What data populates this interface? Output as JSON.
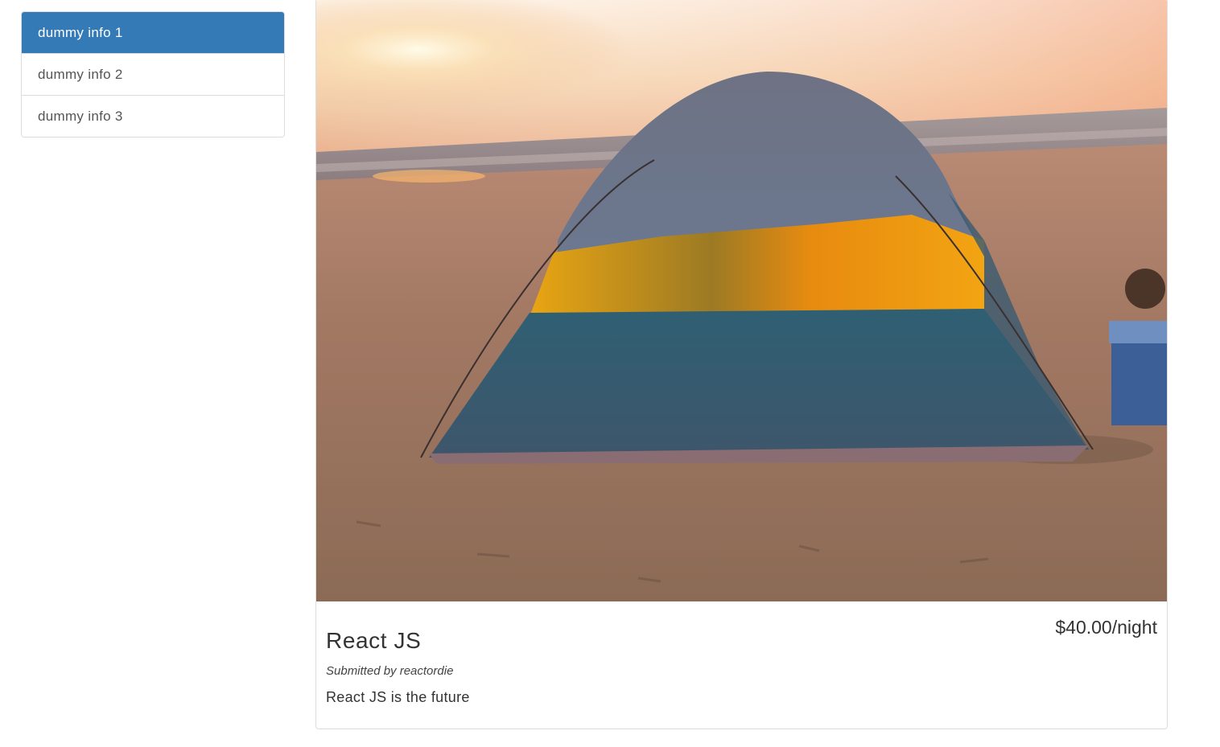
{
  "sidebar": {
    "items": [
      {
        "label": "dummy info 1",
        "active": true
      },
      {
        "label": "dummy info 2",
        "active": false
      },
      {
        "label": "dummy info 3",
        "active": false
      }
    ]
  },
  "listing": {
    "price": "$40.00/night",
    "title": "React JS",
    "submitted_by": "Submitted by reactordie",
    "description": "React JS is the future"
  },
  "colors": {
    "active_item": "#337ab7",
    "border": "#dddddd"
  }
}
